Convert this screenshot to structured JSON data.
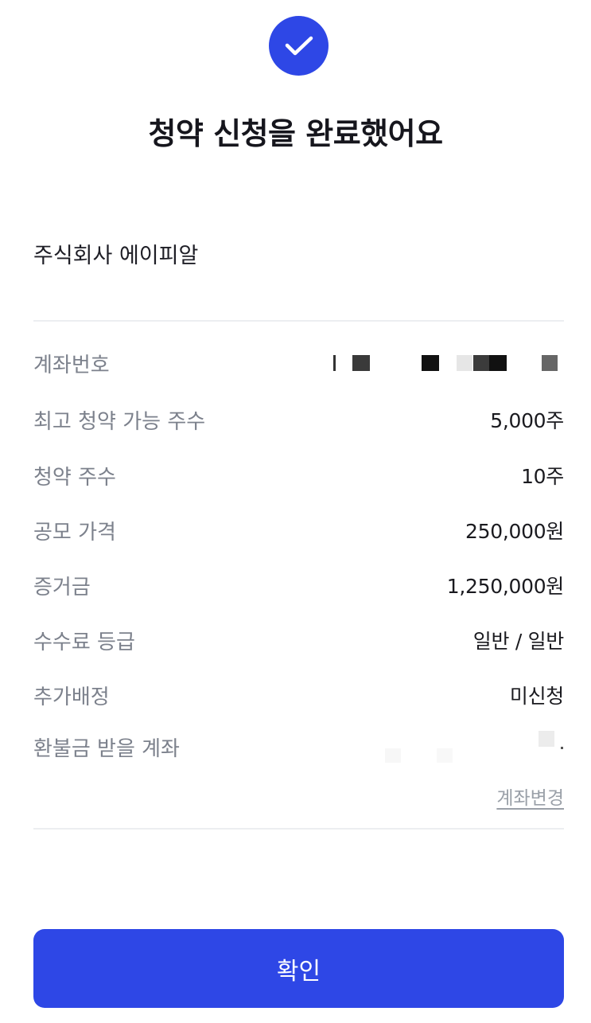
{
  "header": {
    "status_icon": "check-icon",
    "title": "청약 신청을 완료했어요"
  },
  "company": {
    "name": "주식회사 에이피알"
  },
  "details": {
    "account_number": {
      "label": "계좌번호",
      "value": ""
    },
    "max_shares": {
      "label": "최고 청약 가능 주수",
      "value": "5,000주"
    },
    "subscribed_shares": {
      "label": "청약 주수",
      "value": "10주"
    },
    "offering_price": {
      "label": "공모 가격",
      "value": "250,000원"
    },
    "deposit": {
      "label": "증거금",
      "value": "1,250,000원"
    },
    "fee_grade": {
      "label": "수수료 등급",
      "value": "일반 / 일반"
    },
    "additional_allocation": {
      "label": "추가배정",
      "value": "미신청"
    },
    "refund_account": {
      "label": "환불금 받을 계좌",
      "value": ""
    }
  },
  "actions": {
    "change_account_label": "계좌변경",
    "confirm_label": "확인"
  },
  "colors": {
    "accent": "#2e47e6",
    "label_gray": "#7c818c",
    "divider": "#eceef1"
  }
}
